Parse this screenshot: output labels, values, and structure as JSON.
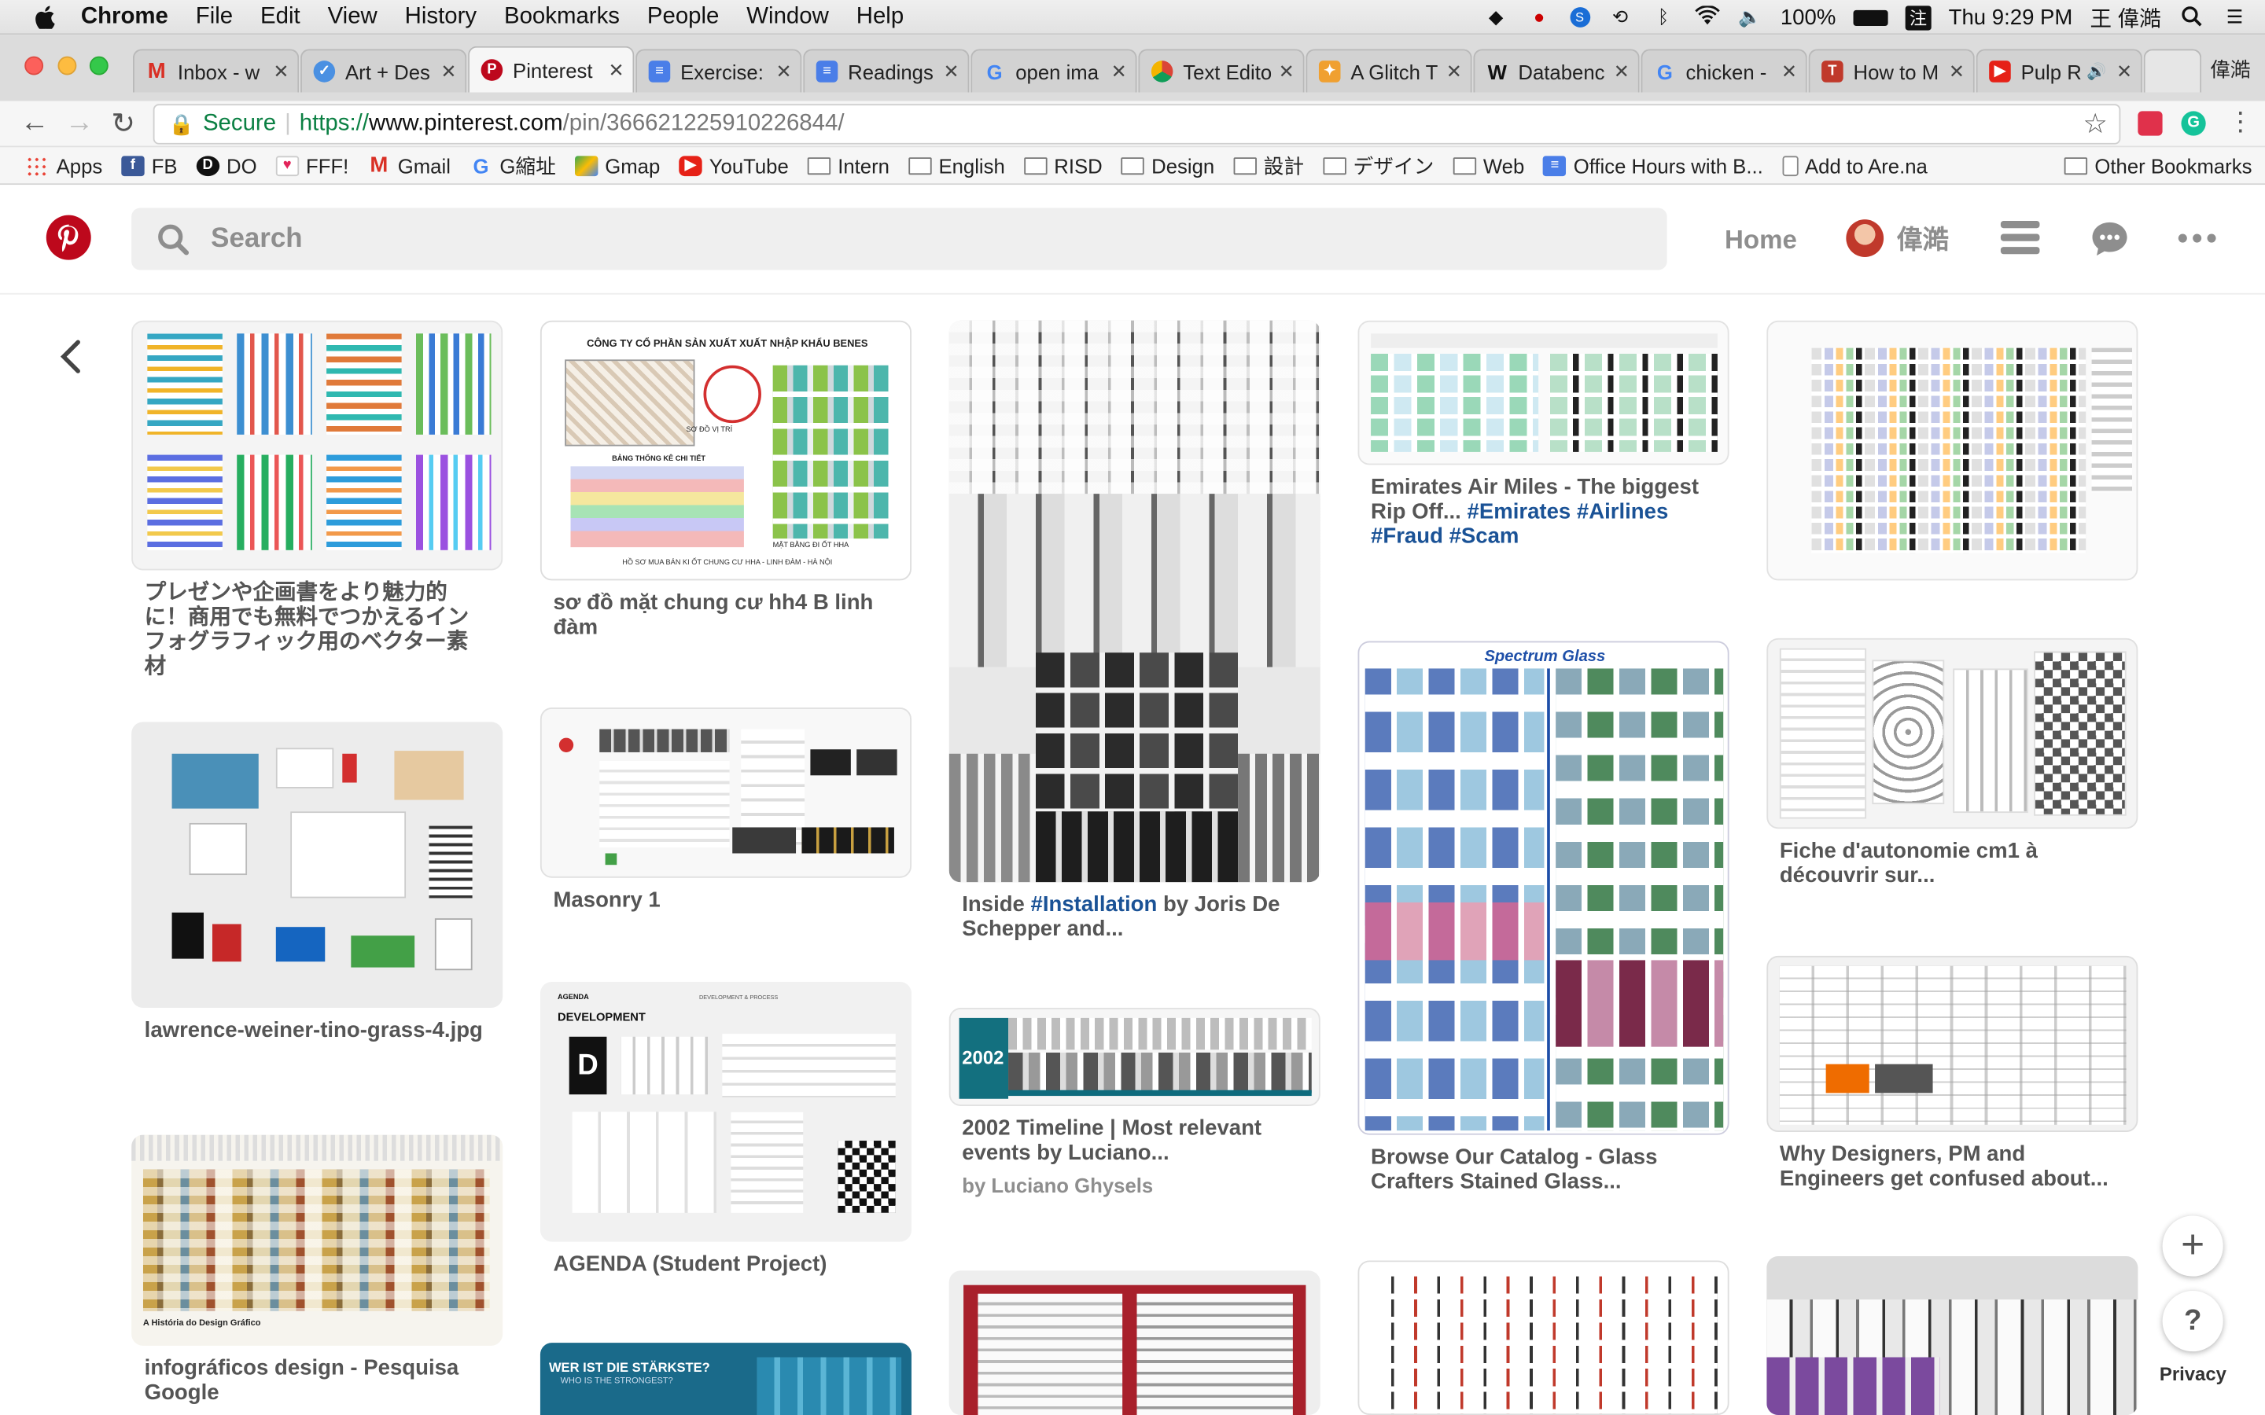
{
  "menubar": {
    "app": "Chrome",
    "items": [
      "File",
      "Edit",
      "View",
      "History",
      "Bookmarks",
      "People",
      "Window",
      "Help"
    ],
    "battery": "100%",
    "input_method": "注",
    "clock": "Thu 9:29 PM",
    "user": "王 偉澔"
  },
  "tabs": [
    {
      "title": "Inbox - w"
    },
    {
      "title": "Art + Des"
    },
    {
      "title": "Pinterest"
    },
    {
      "title": "Exercise:"
    },
    {
      "title": "Readings"
    },
    {
      "title": "open ima"
    },
    {
      "title": "Text Edito"
    },
    {
      "title": "A Glitch T"
    },
    {
      "title": "Databenc"
    },
    {
      "title": "chicken -"
    },
    {
      "title": "How to M"
    },
    {
      "title": "Pulp R"
    }
  ],
  "profile_name": "偉澔",
  "address": {
    "secure_label": "Secure",
    "scheme": "https://",
    "host": "www.pinterest.com",
    "path": "/pin/366621225910226844/"
  },
  "bookmarks": {
    "apps": "Apps",
    "items": [
      "FB",
      "DO",
      "FFF!",
      "Gmail",
      "G縮址",
      "Gmap",
      "YouTube",
      "Intern",
      "English",
      "RISD",
      "Design",
      "設計",
      "デザイン",
      "Web",
      "Office Hours with B...",
      "Add to Are.na"
    ],
    "other": "Other Bookmarks"
  },
  "pinterest": {
    "search_placeholder": "Search",
    "home": "Home",
    "username": "偉澔"
  },
  "pins": {
    "p1": "プレゼンや企画書をより魅力的に！商用でも無料でつかえるインフォグラフィック用のベクター素材",
    "p2": "lawrence-weiner-tino-grass-4.jpg",
    "p3": "infográficos design - Pesquisa Google",
    "p4": "sơ đồ mặt chung cư hh4 B linh đàm",
    "p5": "Masonry 1",
    "p6": "AGENDA (Student Project)",
    "p7_prefix": "Inside ",
    "p7_tag": "#Installation",
    "p7_suffix": " by Joris De Schepper and...",
    "p8": "2002 Timeline | Most relevant events by Luciano...",
    "p8_by": "by Luciano Ghysels",
    "p9_text": "Emirates Air Miles - The biggest Rip Off...",
    "p9_tags": "#Emirates #Airlines #Fraud #Scam",
    "p10": "Browse Our Catalog - Glass Crafters Stained Glass...",
    "p11": "Fiche d'autonomie cm1 à découvrir sur...",
    "p12": "Why Designers, PM and Engineers get confused about..."
  },
  "pin_image_text": {
    "p4_company": "CÔNG TY CỔ PHẦN SẢN XUẤT XUẤT NHẬP KHẨU BENES",
    "p4_sub": "SƠ ĐỒ VỊ TRÍ",
    "p4_table": "BẢNG THỐNG KÊ CHI TIẾT",
    "p4_floor": "MẶT BẰNG ĐI ỐT HHA",
    "p4_footer": "HỒ SƠ MUA BÁN KI ỐT CHUNG CƯ HHA - LINH ĐÀM - HÀ NỘI",
    "p6_brand": "AGENDA",
    "p6_title": "DEVELOPMENT",
    "p6_header": "DEVELOPMENT & PROCESS",
    "p8_year": "2002",
    "p10_title": "Spectrum Glass",
    "p3_bottom": "A História do Design Gráfico",
    "p13_title": "WER IST DIE STÄRKSTE?",
    "p13_sub": "WHO IS THE STRONGEST?"
  },
  "floating": {
    "add": "+",
    "help": "?",
    "privacy": "Privacy"
  },
  "colors": {
    "pinterest_red": "#bd081c",
    "tag_blue": "#1a5296",
    "secure_green": "#0b8043"
  },
  "icons": [
    "apple-icon",
    "dropbox-icon",
    "wifi-icon",
    "bluetooth-icon",
    "search-icon",
    "pinterest-logo",
    "menu-icon",
    "chat-icon",
    "more-icon",
    "back-arrow-icon",
    "star-icon"
  ]
}
